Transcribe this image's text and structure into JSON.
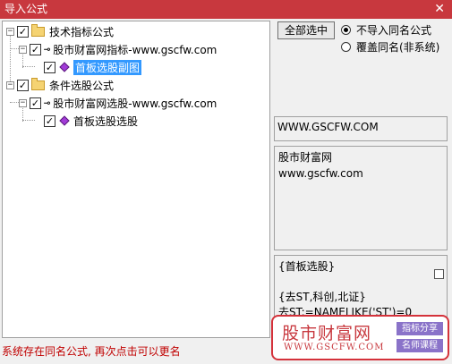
{
  "window": {
    "title": "导入公式",
    "close_glyph": "✕"
  },
  "tree": [
    {
      "label": "技术指标公式",
      "checked": true,
      "expander": "−"
    },
    {
      "label": "股市财富网指标-www.gscfw.com",
      "checked": true,
      "expander": "−"
    },
    {
      "label": "首板选股副图",
      "checked": true,
      "selected": true
    },
    {
      "label": "条件选股公式",
      "checked": true,
      "expander": "−"
    },
    {
      "label": "股市财富网选股-www.gscfw.com",
      "checked": true,
      "expander": "−"
    },
    {
      "label": "首板选股选股",
      "checked": true
    }
  ],
  "controls": {
    "select_all_label": "全部选中",
    "radio_options": [
      {
        "label": "不导入同名公式",
        "selected": true
      },
      {
        "label": "覆盖同名(非系统)",
        "selected": false
      }
    ]
  },
  "panels": {
    "site": "WWW.GSCFW.COM",
    "desc_lines": [
      "股市财富网",
      "www.gscfw.com"
    ],
    "code_lines": [
      "{首板选股}",
      "",
      "{去ST,科创,北证}",
      "去ST:=NAMELIKE('ST')=0"
    ]
  },
  "watermark": {
    "name": "股市财富网",
    "url": "WWW.GSCFW.COM",
    "tag1": "指标分享",
    "tag2": "名师课程"
  },
  "status": {
    "text": "系统存在同名公式, 再次点击可以更名"
  },
  "colors": {
    "titlebar": "#c8383e",
    "selection": "#3399ff",
    "status_text": "#c00000",
    "formula_icon": "#a23bd8"
  }
}
